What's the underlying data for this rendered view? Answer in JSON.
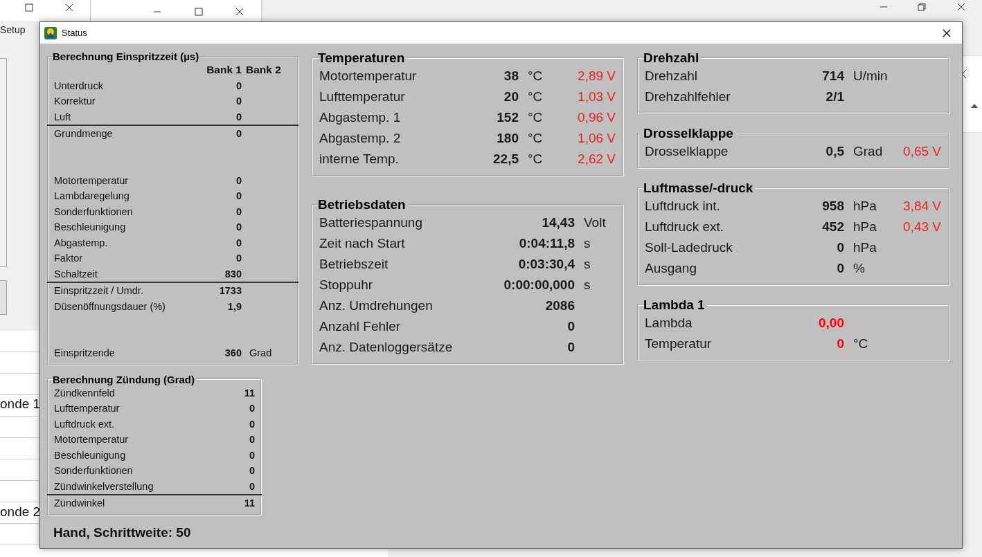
{
  "background": {
    "menu": [
      "Setup"
    ],
    "side_cells": [
      "onde 1",
      "onde 2"
    ]
  },
  "dialog": {
    "title": "Status"
  },
  "injection": {
    "title": "Berechnung Einspritzzeit (µs)",
    "columns": [
      "Bank 1",
      "Bank 2"
    ],
    "rows": [
      {
        "label": "Unterdruck",
        "value": "0",
        "kind": "plain",
        "spaced": false
      },
      {
        "label": "Korrektur",
        "value": "0",
        "kind": "plain",
        "spaced": false
      },
      {
        "label": "Luft",
        "value": "0",
        "kind": "plain",
        "spaced": false
      },
      {
        "label": "Grundmenge",
        "value": "0",
        "kind": "total",
        "spaced": false
      },
      {
        "label": "Motortemperatur",
        "value": "0",
        "kind": "plain",
        "spaced": true
      },
      {
        "label": "Lambdaregelung",
        "value": "0",
        "kind": "plain",
        "spaced": false
      },
      {
        "label": "Sonderfunktionen",
        "value": "0",
        "kind": "plain",
        "spaced": false
      },
      {
        "label": "Beschleunigung",
        "value": "0",
        "kind": "plain",
        "spaced": false
      },
      {
        "label": "Abgastemp.",
        "value": "0",
        "kind": "plain",
        "spaced": false
      },
      {
        "label": "Faktor",
        "value": "0",
        "kind": "plain",
        "spaced": false
      },
      {
        "label": "Schaltzeit",
        "value": "830",
        "kind": "plain",
        "spaced": false
      },
      {
        "label": "Einspritzzeit / Umdr.",
        "value": "1733",
        "kind": "total",
        "spaced": false
      },
      {
        "label": "Düsenöffnungsdauer (%)",
        "value": "1,9",
        "kind": "plain",
        "spaced": false
      },
      {
        "label": "Einspritzende",
        "value": "360",
        "unit": "Grad",
        "kind": "plain",
        "spaced": true
      }
    ]
  },
  "ignition": {
    "title": "Berechnung Zündung (Grad)",
    "rows": [
      {
        "label": "Zündkennfeld",
        "value": "11",
        "kind": "plain",
        "spaced": false
      },
      {
        "label": "Lufttemperatur",
        "value": "0",
        "kind": "plain",
        "spaced": false
      },
      {
        "label": "Luftdruck ext.",
        "value": "0",
        "kind": "plain",
        "spaced": false
      },
      {
        "label": "Motortemperatur",
        "value": "0",
        "kind": "plain",
        "spaced": false
      },
      {
        "label": "Beschleunigung",
        "value": "0",
        "kind": "plain",
        "spaced": false
      },
      {
        "label": "Sonderfunktionen",
        "value": "0",
        "kind": "plain",
        "spaced": false
      },
      {
        "label": "Zündwinkelverstellung",
        "value": "0",
        "kind": "plain",
        "spaced": false
      },
      {
        "label": "Zündwinkel",
        "value": "11",
        "kind": "total",
        "spaced": false
      }
    ]
  },
  "mode_text": "Hand, Schrittweite: 50",
  "middle_groups": [
    {
      "title": "Temperaturen",
      "kind": "sensor",
      "rows": [
        {
          "label": "Motortemperatur",
          "value": "38",
          "unit": "°C",
          "voltage": "2,89 V",
          "alert": false
        },
        {
          "label": "Lufttemperatur",
          "value": "20",
          "unit": "°C",
          "voltage": "1,03 V",
          "alert": false
        },
        {
          "label": "Abgastemp. 1",
          "value": "152",
          "unit": "°C",
          "voltage": "0,96 V",
          "alert": false
        },
        {
          "label": "Abgastemp. 2",
          "value": "180",
          "unit": "°C",
          "voltage": "1,06 V",
          "alert": false
        },
        {
          "label": "interne Temp.",
          "value": "22,5",
          "unit": "°C",
          "voltage": "2,62 V",
          "alert": false
        }
      ]
    },
    {
      "title": "Betriebsdaten",
      "kind": "wide",
      "rows": [
        {
          "label": "Batteriespannung",
          "value": "14,43",
          "unit": "Volt",
          "alert": false
        },
        {
          "label": "Zeit nach Start",
          "value": "0:04:11,8",
          "unit": "s",
          "alert": false
        },
        {
          "label": "Betriebszeit",
          "value": "0:03:30,4",
          "unit": "s",
          "alert": false
        },
        {
          "label": "Stoppuhr",
          "value": "0:00:00,000",
          "unit": "s",
          "alert": false
        },
        {
          "label": "Anz. Umdrehungen",
          "value": "2086",
          "alert": false
        },
        {
          "label": "Anzahl Fehler",
          "value": "0",
          "alert": false
        },
        {
          "label": "Anz. Datenloggersätze",
          "value": "0",
          "alert": false
        }
      ]
    }
  ],
  "right_groups": [
    {
      "title": "Drehzahl",
      "kind": "sensor",
      "rows": [
        {
          "label": "Drehzahl",
          "value": "714",
          "unit": "U/min",
          "alert": false
        },
        {
          "label": "Drehzahlfehler",
          "value": "2/1",
          "alert": false
        }
      ]
    },
    {
      "title": "Drosselklappe",
      "kind": "sensor",
      "rows": [
        {
          "label": "Drosselklappe",
          "value": "0,5",
          "unit": "Grad",
          "voltage": "0,65 V",
          "alert": false
        }
      ]
    },
    {
      "title": "Luftmasse/-druck",
      "kind": "sensor",
      "rows": [
        {
          "label": "Luftdruck int.",
          "value": "958",
          "unit": "hPa",
          "voltage": "3,84 V",
          "alert": false
        },
        {
          "label": "Luftdruck ext.",
          "value": "452",
          "unit": "hPa",
          "voltage": "0,43 V",
          "alert": false
        },
        {
          "label": "Soll-Ladedruck",
          "value": "0",
          "unit": "hPa",
          "alert": false
        },
        {
          "label": "Ausgang",
          "value": "0",
          "unit": "%",
          "alert": false
        }
      ]
    },
    {
      "title": "Lambda 1",
      "kind": "sensor",
      "rows": [
        {
          "label": "Lambda",
          "value": "0,00",
          "alert": true
        },
        {
          "label": "Temperatur",
          "value": "0",
          "unit": "°C",
          "alert": true
        }
      ]
    }
  ]
}
